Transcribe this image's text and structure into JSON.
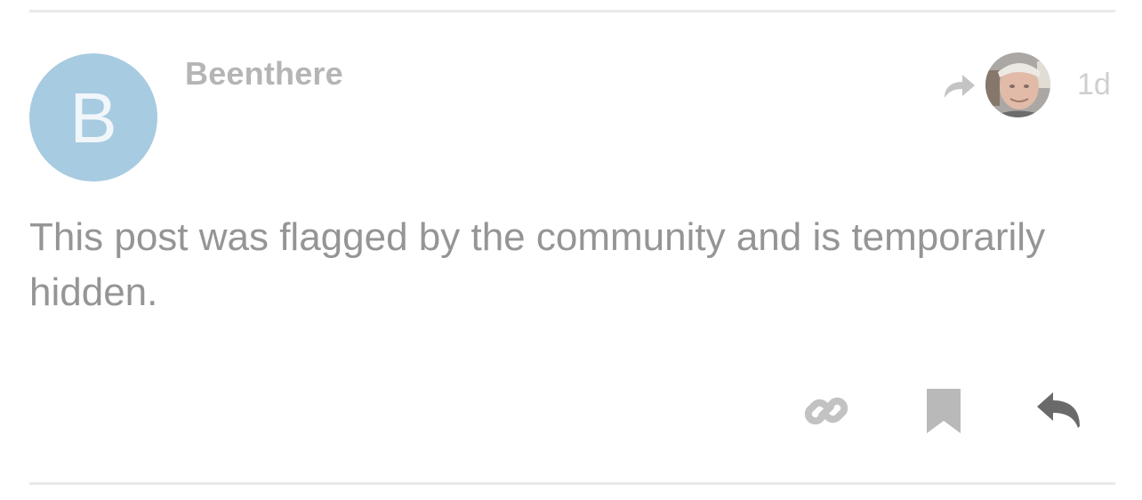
{
  "post": {
    "author": {
      "username": "Beenthere",
      "avatar_letter": "B",
      "avatar_color": "#a3c9df"
    },
    "reply_to_icon": "share-arrow-icon",
    "time": "1d",
    "body_text": "This post was flagged by the community and is temporarily hidden.",
    "actions": {
      "copy_link_icon": "link-icon",
      "bookmark_icon": "bookmark-icon",
      "reply_icon": "reply-icon"
    }
  }
}
